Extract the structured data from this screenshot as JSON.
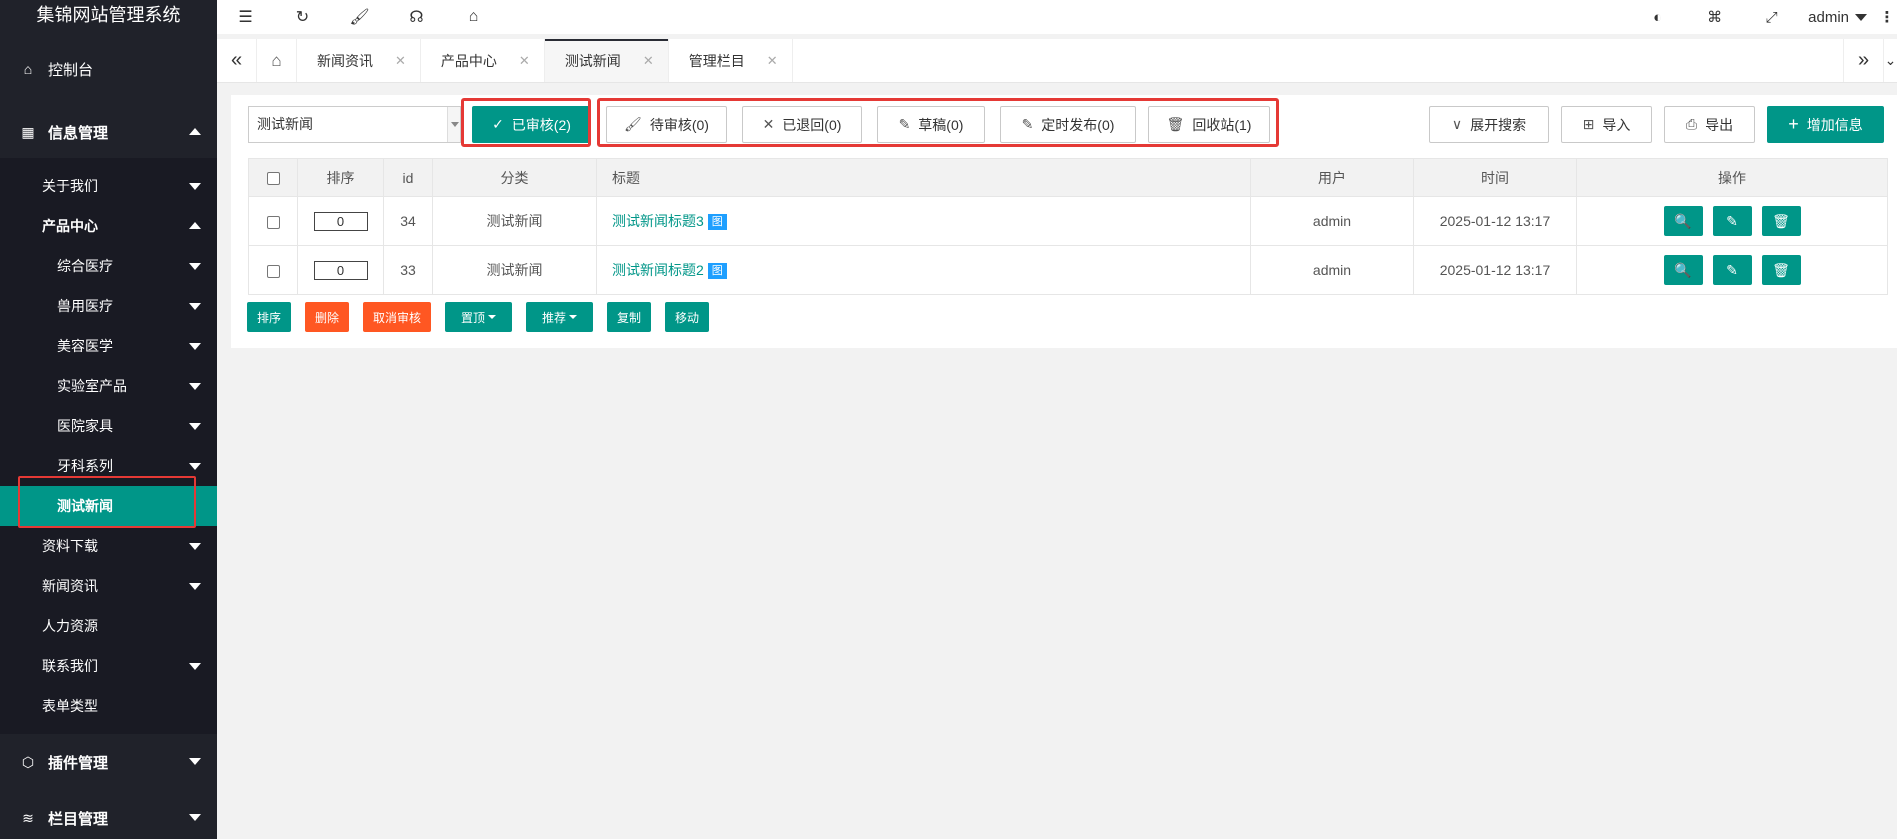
{
  "app_title": "集锦网站管理系统",
  "sidebar": {
    "dashboard": "控制台",
    "info_mgmt": "信息管理",
    "items": [
      {
        "label": "关于我们",
        "arrow": "down"
      },
      {
        "label": "产品中心",
        "arrow": "up"
      },
      {
        "label": "综合医疗",
        "arrow": "down"
      },
      {
        "label": "兽用医疗",
        "arrow": "down"
      },
      {
        "label": "美容医学",
        "arrow": "down"
      },
      {
        "label": "实验室产品",
        "arrow": "down"
      },
      {
        "label": "医院家具",
        "arrow": "down"
      },
      {
        "label": "牙科系列",
        "arrow": "down"
      },
      {
        "label": "测试新闻",
        "arrow": "none"
      },
      {
        "label": "资料下载",
        "arrow": "down"
      },
      {
        "label": "新闻资讯",
        "arrow": "down"
      },
      {
        "label": "人力资源",
        "arrow": "none"
      },
      {
        "label": "联系我们",
        "arrow": "down"
      },
      {
        "label": "表单类型",
        "arrow": "none"
      }
    ],
    "plugin_mgmt": "插件管理",
    "column_mgmt": "栏目管理"
  },
  "header": {
    "user": "admin"
  },
  "tabs": [
    {
      "label": "新闻资讯"
    },
    {
      "label": "产品中心"
    },
    {
      "label": "测试新闻",
      "active": true
    },
    {
      "label": "管理栏目"
    }
  ],
  "toolbar": {
    "category_select": "测试新闻",
    "status_buttons": {
      "approved": "已审核(2)",
      "pending": "待审核(0)",
      "returned": "已退回(0)",
      "draft": "草稿(0)",
      "scheduled": "定时发布(0)",
      "recycle": "回收站(1)"
    },
    "expand_search": "展开搜索",
    "import": "导入",
    "export": "导出",
    "add": "增加信息"
  },
  "table": {
    "headers": {
      "order": "排序",
      "id": "id",
      "category": "分类",
      "title": "标题",
      "user": "用户",
      "time": "时间",
      "ops": "操作"
    },
    "rows": [
      {
        "order": "0",
        "id": "34",
        "category": "测试新闻",
        "title": "测试新闻标题3",
        "badge": "图",
        "user": "admin",
        "time": "2025-01-12 13:17"
      },
      {
        "order": "0",
        "id": "33",
        "category": "测试新闻",
        "title": "测试新闻标题2",
        "badge": "图",
        "user": "admin",
        "time": "2025-01-12 13:17"
      }
    ]
  },
  "actions": {
    "sort": "排序",
    "delete": "删除",
    "unapprove": "取消审核",
    "top": "置顶",
    "recommend": "推荐",
    "copy": "复制",
    "move": "移动"
  },
  "colors": {
    "accent": "#009688",
    "danger": "#ff5722",
    "sidebar_bg": "#20222a",
    "highlight_box": "#e53935",
    "badge": "#1e9fff"
  }
}
